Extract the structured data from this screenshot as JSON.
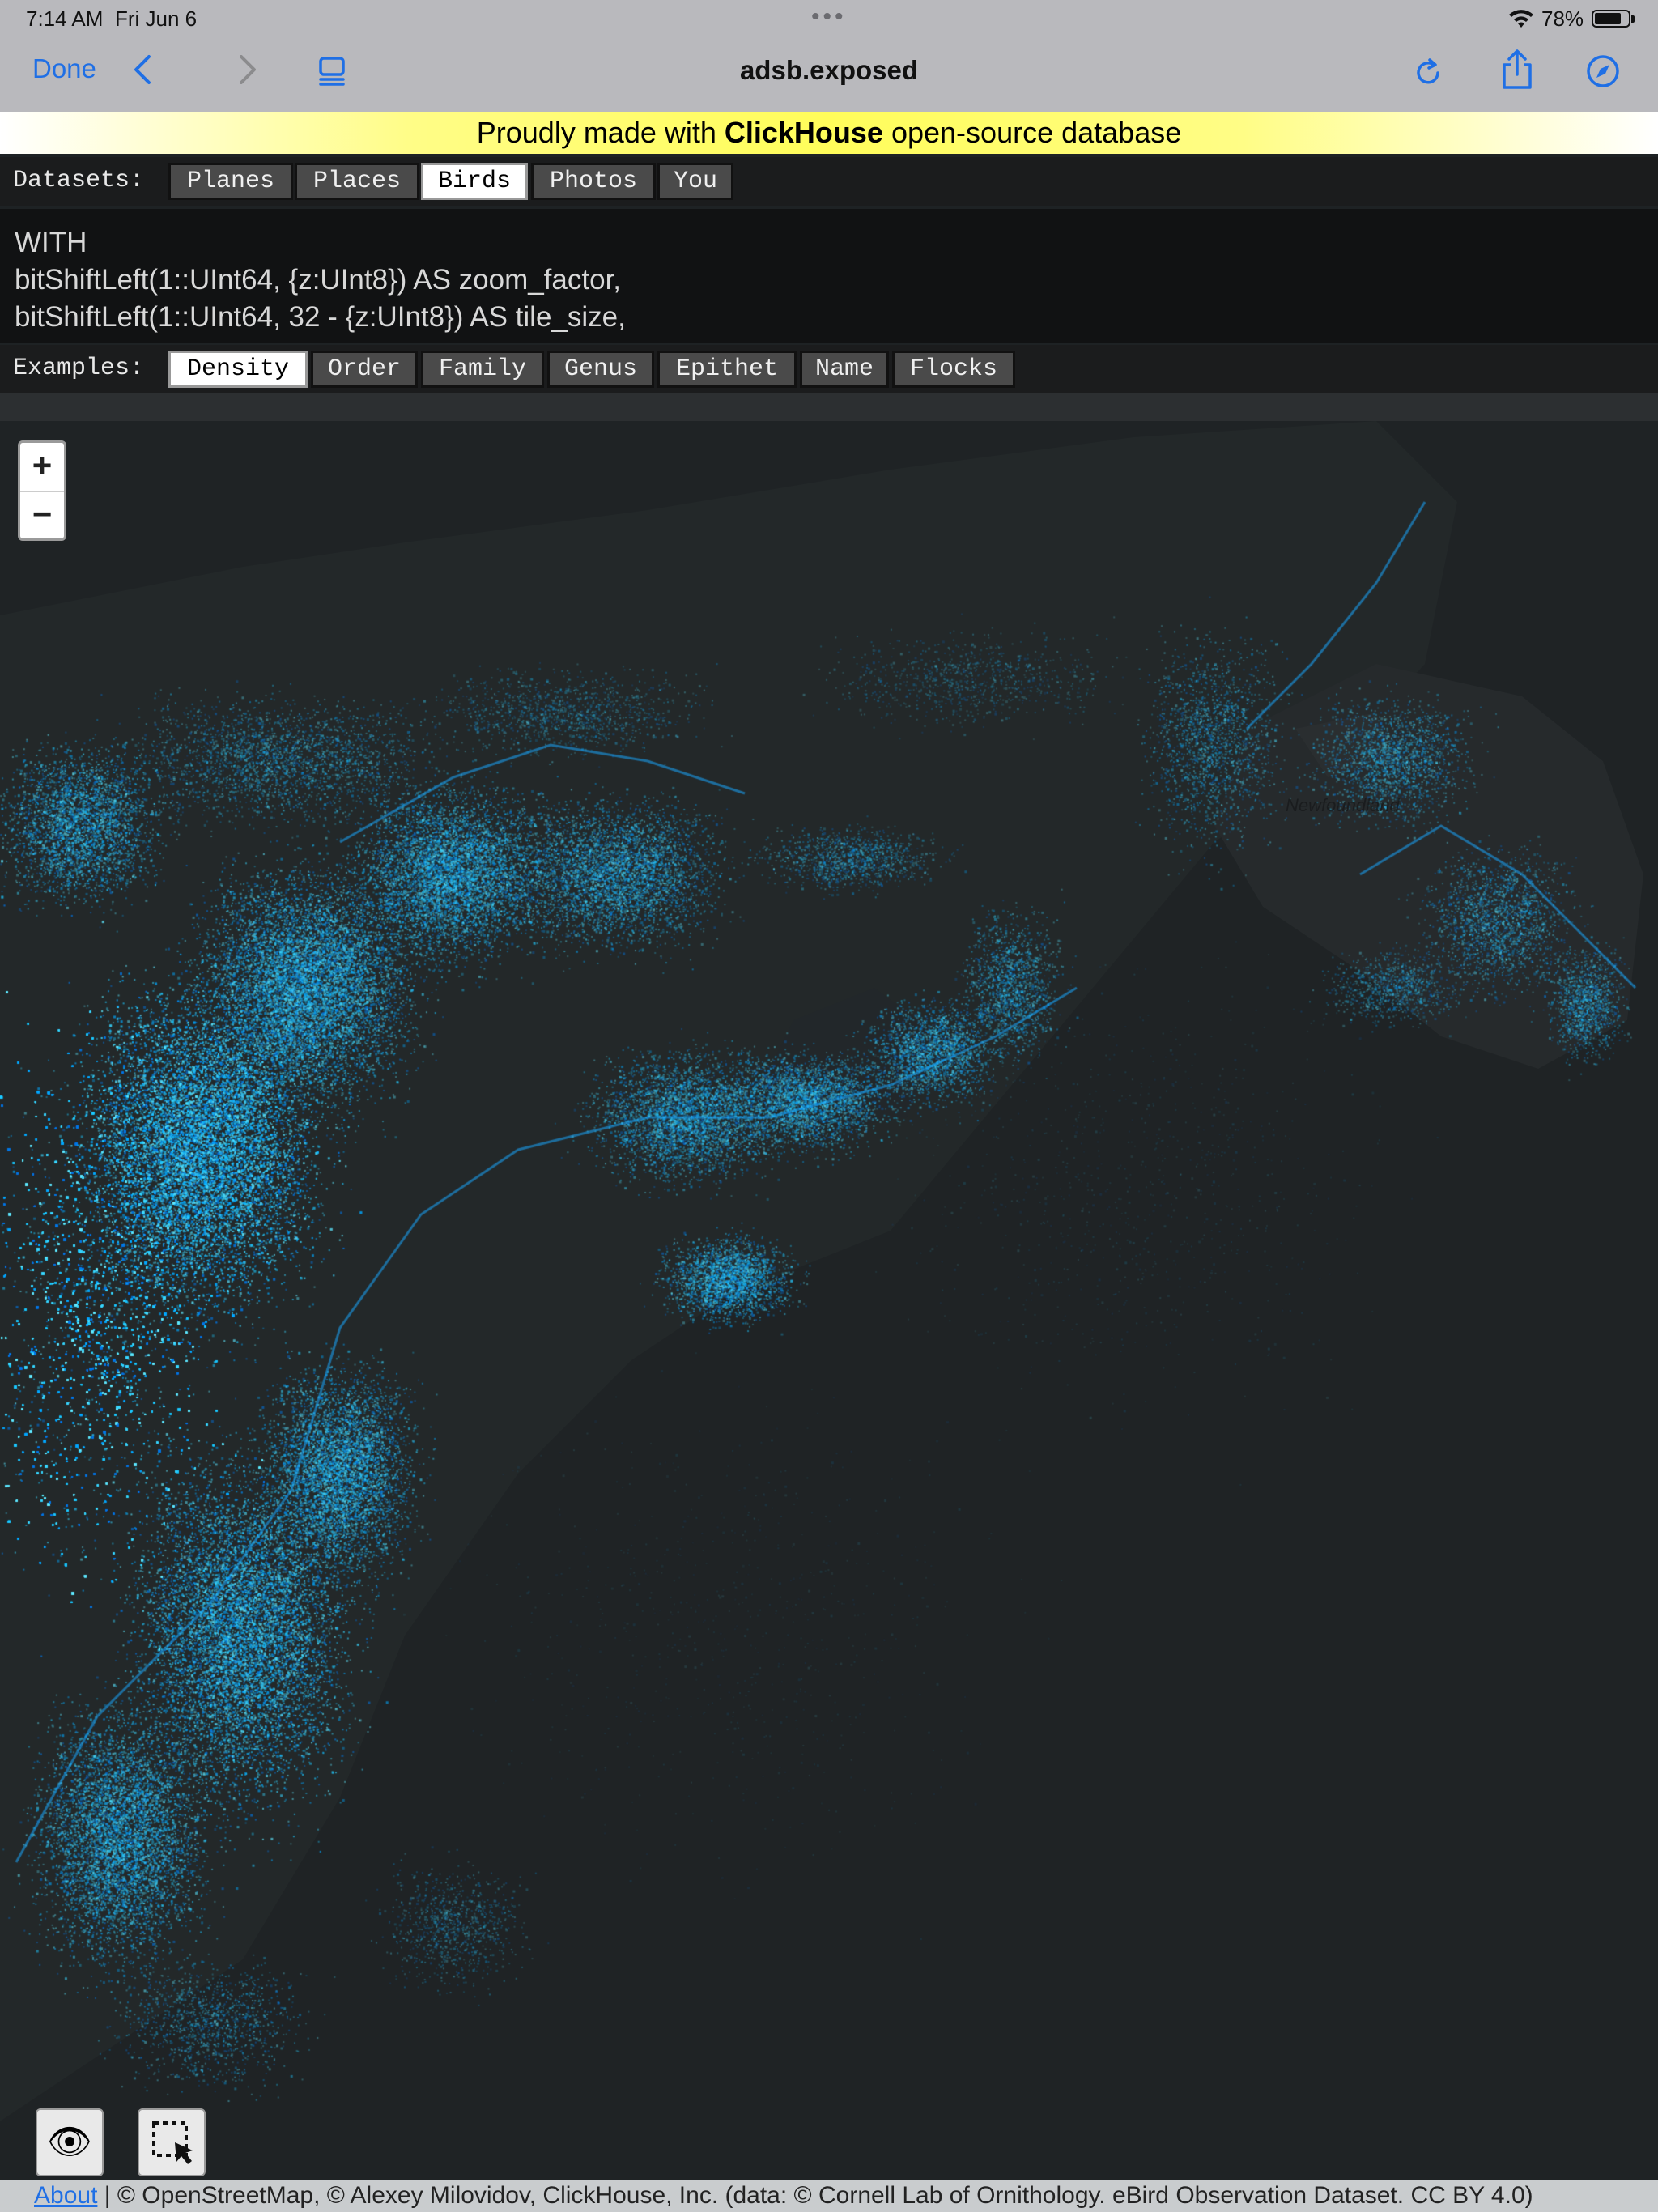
{
  "status_bar": {
    "time": "7:14 AM",
    "date": "Fri Jun 6",
    "battery": "78%"
  },
  "toolbar": {
    "done_label": "Done",
    "title": "adsb.exposed",
    "icons": [
      "chevron-left-icon",
      "chevron-right-icon",
      "tabs-icon",
      "reload-icon",
      "share-icon",
      "compass-icon"
    ]
  },
  "banner": {
    "prefix": "Proudly made with ",
    "brand": "ClickHouse",
    "suffix": " open-source database"
  },
  "datasets": {
    "label": "Datasets:",
    "items": [
      "Planes",
      "Places",
      "Birds",
      "Photos",
      "You"
    ],
    "active": "Birds"
  },
  "query": {
    "lines": [
      "WITH",
      "bitShiftLeft(1::UInt64, {z:UInt8}) AS zoom_factor,",
      "bitShiftLeft(1::UInt64, 32 - {z:UInt8}) AS tile_size,"
    ]
  },
  "examples": {
    "label": "Examples:",
    "items": [
      "Density",
      "Order",
      "Family",
      "Genus",
      "Epithet",
      "Name",
      "Flocks"
    ],
    "active": "Density"
  },
  "map": {
    "zoom_in": "+",
    "zoom_out": "−",
    "place_labels": [
      "Newfoundland"
    ],
    "point_colors": [
      "#00a8ff",
      "#1ec8ff",
      "#3ad6ff",
      "#0077e6",
      "#60e8ff"
    ]
  },
  "tools": {
    "eye_glyph": "👁"
  },
  "attribution": {
    "about": "About",
    "text": " | © OpenStreetMap, © Alexey Milovidov, ClickHouse, Inc. (data: © Cornell Lab of Ornithology. eBird Observation Dataset. CC BY 4.0)"
  }
}
